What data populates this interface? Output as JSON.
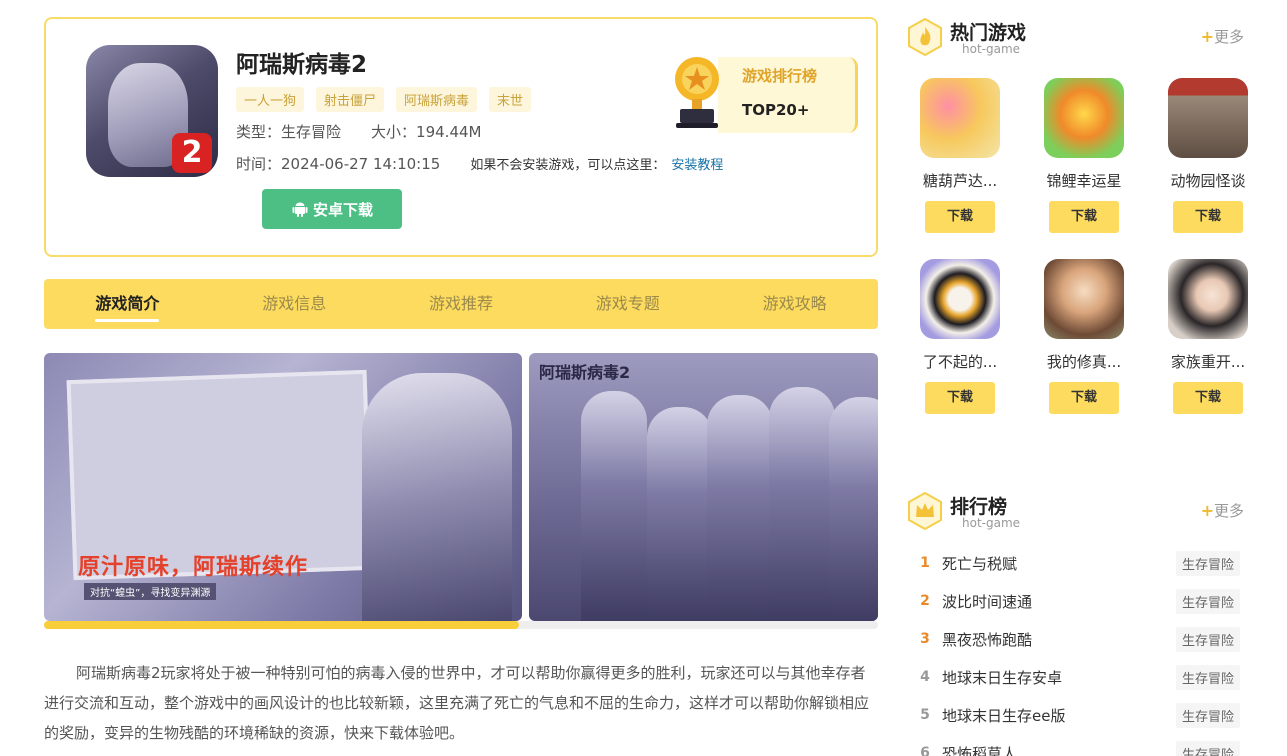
{
  "game": {
    "title": "阿瑞斯病毒2",
    "tags": [
      "一人一狗",
      "射击僵尸",
      "阿瑞斯病毒",
      "末世"
    ],
    "type_label": "类型：",
    "type_value": "生存冒险",
    "size_label": "大小：",
    "size_value": "194.44M",
    "time_label": "时间：",
    "time_value": "2024-06-27 14:10:15",
    "install_hint": "如果不会安装游戏，可以点这里：",
    "install_link": "安装教程",
    "download_label": "安卓下载",
    "rank_badge": {
      "title": "游戏排行榜",
      "rank": "TOP20+"
    }
  },
  "tabs": [
    {
      "label": "游戏简介",
      "active": true
    },
    {
      "label": "游戏信息",
      "active": false
    },
    {
      "label": "游戏推荐",
      "active": false
    },
    {
      "label": "游戏专题",
      "active": false
    },
    {
      "label": "游戏攻略",
      "active": false
    }
  ],
  "screenshots": {
    "shot1_caption": "原汁原味，阿瑞斯续作",
    "shot1_sub": "对抗“蝗虫”，寻找变异渊源",
    "shot2_logo": "阿瑞斯病毒2",
    "gallery_progress": 0.57
  },
  "intro": "阿瑞斯病毒2玩家将处于被一种特别可怕的病毒入侵的世界中，才可以帮助你赢得更多的胜利，玩家还可以与其他幸存者进行交流和互动，整个游戏中的画风设计的也比较新颖，这里充满了死亡的气息和不屈的生命力，这样才可以帮助你解锁相应的奖励，变异的生物残酷的环境稀缺的资源，快来下载体验吧。",
  "hot_games": {
    "title": "热门游戏",
    "subtitle": "hot-game",
    "more": "更多",
    "items": [
      {
        "name": "糖葫芦达...",
        "button": "下载",
        "color": "#f3c66b"
      },
      {
        "name": "锦鲤幸运星",
        "button": "下载",
        "color": "#8fd36b"
      },
      {
        "name": "动物园怪谈",
        "button": "下载",
        "color": "#8a7a6b"
      },
      {
        "name": "了不起的...",
        "button": "下载",
        "color": "#9b92d6"
      },
      {
        "name": "我的修真...",
        "button": "下载",
        "color": "#c9a27d"
      },
      {
        "name": "家族重开...",
        "button": "下载",
        "color": "#d8c4b4"
      }
    ]
  },
  "ranking": {
    "title": "排行榜",
    "subtitle": "hot-game",
    "more": "更多",
    "items": [
      {
        "rank": "1",
        "name": "死亡与税赋",
        "category": "生存冒险"
      },
      {
        "rank": "2",
        "name": "波比时间速通",
        "category": "生存冒险"
      },
      {
        "rank": "3",
        "name": "黑夜恐怖跑酷",
        "category": "生存冒险"
      },
      {
        "rank": "4",
        "name": "地球末日生存安卓",
        "category": "生存冒险"
      },
      {
        "rank": "5",
        "name": "地球末日生存ee版",
        "category": "生存冒险"
      },
      {
        "rank": "6",
        "name": "恐怖稻草人",
        "category": "生存冒险"
      }
    ]
  }
}
